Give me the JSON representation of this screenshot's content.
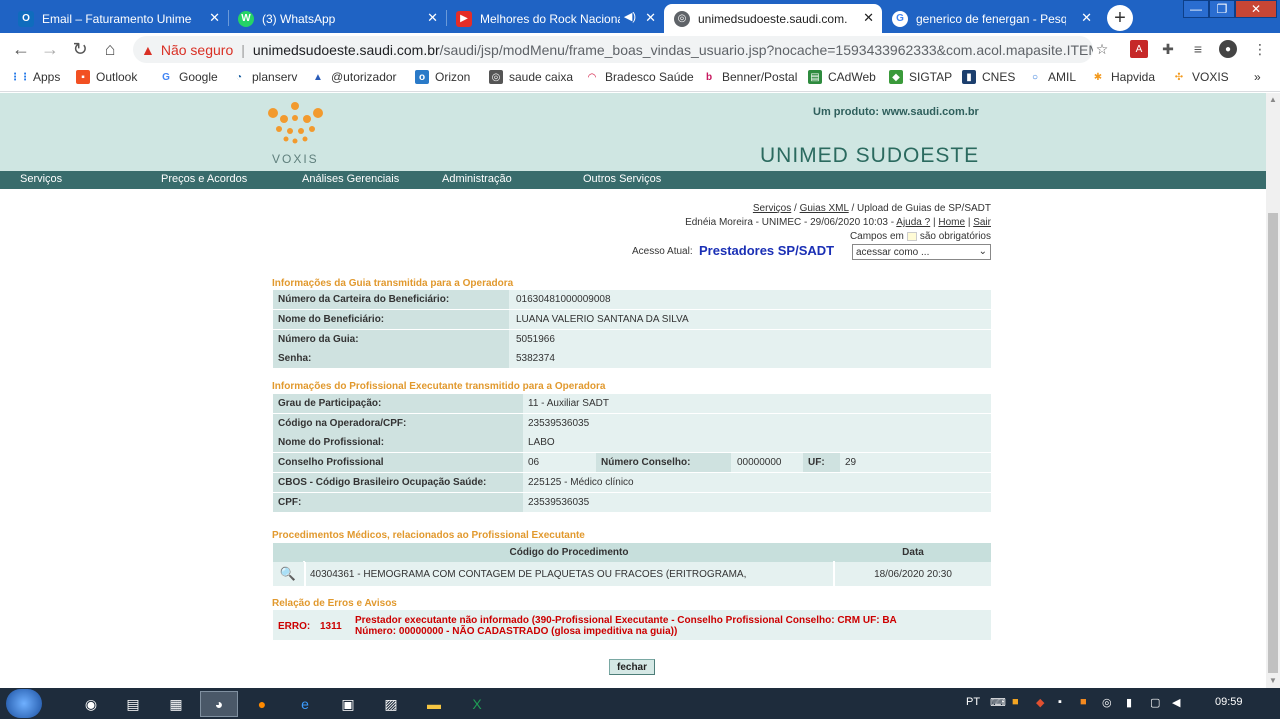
{
  "browser": {
    "tabs": [
      {
        "title": "Email – Faturamento Unimec – O",
        "icon_color": "#0f6cbd",
        "icon_glyph": "O"
      },
      {
        "title": "(3) WhatsApp",
        "icon_color": "#25d366",
        "icon_glyph": "W"
      },
      {
        "title": "Melhores do Rock Nacional",
        "icon_color": "#e52d27",
        "icon_glyph": "▶"
      },
      {
        "title": "unimedsudoeste.saudi.com.br/sa",
        "icon_color": "#5f6368",
        "icon_glyph": "◎"
      },
      {
        "title": "generico de fenergan - Pesquisa",
        "icon_color": "#ffffff",
        "icon_glyph": "G"
      }
    ],
    "new_tab": "+",
    "close_glyph": "✕",
    "mute_glyph": "◀)",
    "window_controls": {
      "minimize": "—",
      "restore": "❐",
      "close": "✕"
    },
    "nav": {
      "back": "←",
      "forward": "→",
      "reload": "↻",
      "home": "⌂"
    },
    "security_label": "Não seguro",
    "url_domain": "unimedsudoeste.saudi.com.br",
    "url_path": "/saudi/jsp/modMenu/frame_boas_vindas_usuario.jsp?nocache=1593433962333&com.acol.mapasite.ITEM_MENU...",
    "bookmarks": [
      {
        "label": "Apps",
        "icon": "apps-icon"
      },
      {
        "label": "Outlook",
        "icon": "windows-icon"
      },
      {
        "label": "Google",
        "icon": "google-icon"
      },
      {
        "label": "planserv",
        "icon": "planserv-icon"
      },
      {
        "label": "@utorizador",
        "icon": "autorizador-icon"
      },
      {
        "label": "Orizon",
        "icon": "orizon-icon"
      },
      {
        "label": "saude caixa",
        "icon": "globe-icon"
      },
      {
        "label": "Bradesco Saúde",
        "icon": "bradesco-icon"
      },
      {
        "label": "Benner/Postal",
        "icon": "benner-icon"
      },
      {
        "label": "CAdWeb",
        "icon": "cadweb-icon"
      },
      {
        "label": "SIGTAP",
        "icon": "sigtap-icon"
      },
      {
        "label": "CNES",
        "icon": "cnes-icon"
      },
      {
        "label": "AMIL",
        "icon": "amil-icon"
      },
      {
        "label": "Hapvida",
        "icon": "hapvida-icon"
      },
      {
        "label": "VOXIS",
        "icon": "voxis-icon"
      }
    ],
    "bookmarks_more": "»"
  },
  "page": {
    "logo_text": "VOXIS",
    "product_text": "Um produto: www.saudi.com.br",
    "brand_title": "UNIMED SUDOESTE",
    "menu": [
      "Serviços",
      "Preços e Acordos",
      "Análises Gerenciais",
      "Administração",
      "Outros Serviços"
    ],
    "breadcrumb": {
      "item1": "Serviços",
      "sep1": " / ",
      "item2": "Guias XML",
      "sep2": " / ",
      "current": "Upload de Guias de SP/SADT"
    },
    "user_line": {
      "text": "Ednéia Moreira - UNIMEC - 29/06/2020 10:03 - ",
      "help": "Ajuda ?",
      "sep1": " | ",
      "home": "Home",
      "sep2": " | ",
      "exit": "Sair"
    },
    "required_note": {
      "pre": "Campos em",
      "post": "são obrigatórios"
    },
    "access": {
      "label": "Acesso Atual:",
      "value": "Prestadores SP/SADT",
      "select_value": "acessar como ..."
    },
    "guia_section": {
      "title": "Informações da Guia transmitida para a Operadora",
      "rows": [
        {
          "label": "Número da Carteira do Beneficiário:",
          "value": "01630481000009008"
        },
        {
          "label": "Nome do Beneficiário:",
          "value": "LUANA VALERIO SANTANA DA SILVA"
        },
        {
          "label": "Número da Guia:",
          "value": "5051966"
        },
        {
          "label": "Senha:",
          "value": "5382374"
        }
      ]
    },
    "prof_section": {
      "title": "Informações do Profissional Executante transmitido para a Operadora",
      "grau_label": "Grau de Participação:",
      "grau_value": "11 -  Auxiliar SADT",
      "codigo_label": "Código na Operadora/CPF:",
      "codigo_value": "23539536035",
      "nome_label": "Nome do Profissional:",
      "nome_value": "LABO",
      "conselho_label": "Conselho Profissional",
      "conselho_value": "06",
      "numero_label": "Número Conselho:",
      "numero_value": "00000000",
      "uf_label": "UF:",
      "uf_value": "29",
      "cbos_label": "CBOS - Código Brasileiro Ocupação Saúde:",
      "cbos_value": "225125 -  Médico clínico",
      "cpf_label": "CPF:",
      "cpf_value": "23539536035"
    },
    "proc_section": {
      "title": "Procedimentos Médicos, relacionados ao Profissional Executante",
      "headers": [
        "Código do Procedimento",
        "Data"
      ],
      "rows": [
        {
          "code": "40304361 -  HEMOGRAMA COM CONTAGEM DE PLAQUETAS OU FRACOES (ERITROGRAMA,",
          "date": "18/06/2020 20:30"
        }
      ]
    },
    "errors_section": {
      "title": "Relação de Erros e Avisos",
      "type": "ERRO:",
      "code": "1311",
      "message_line1": "Prestador executante não informado (390-Profissional Executante - Conselho Profissional Conselho: CRM UF: BA",
      "message_line2": "Número: 00000000 - NÃO CADASTRADO (glosa impeditiva na guia))"
    },
    "close_button": "fechar"
  },
  "taskbar": {
    "tray_lang": "PT",
    "time": "09:59"
  },
  "colors": {
    "header_bg": "#cfe6e2",
    "menu_bg": "#396c6c",
    "section_title": "#e1992e",
    "error_red": "#cc0000",
    "access_blue": "#1a2fb5",
    "tabstrip": "#1f63c4"
  }
}
